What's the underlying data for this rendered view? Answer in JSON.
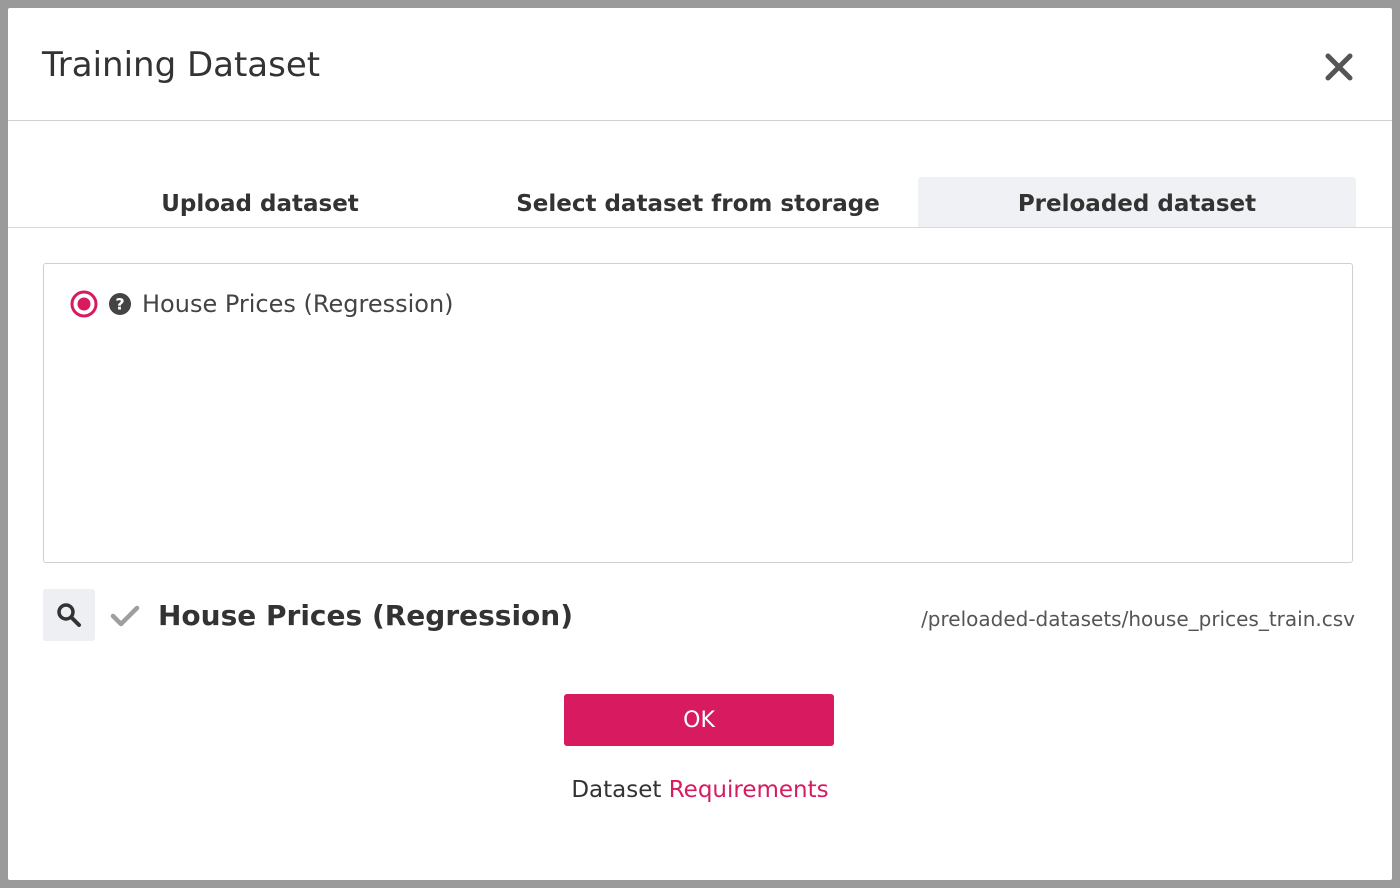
{
  "dialog": {
    "title": "Training Dataset",
    "close_icon": "close-icon"
  },
  "tabs": [
    {
      "label": "Upload dataset",
      "active": false
    },
    {
      "label": "Select dataset from storage",
      "active": false
    },
    {
      "label": "Preloaded dataset",
      "active": true
    }
  ],
  "dataset_options": [
    {
      "label": "House Prices (Regression)",
      "selected": true,
      "icon": "help-icon"
    }
  ],
  "selection": {
    "name": "House Prices (Regression)",
    "path": "/preloaded-datasets/house_prices_train.csv",
    "search_icon": "search-icon",
    "status_icon": "check-icon"
  },
  "actions": {
    "ok_label": "OK"
  },
  "footer": {
    "prefix": "Dataset",
    "link_label": "Requirements"
  },
  "colors": {
    "accent": "#d81b60",
    "overlay": "#9a9a9a",
    "active_tab": "#f0f1f4"
  }
}
